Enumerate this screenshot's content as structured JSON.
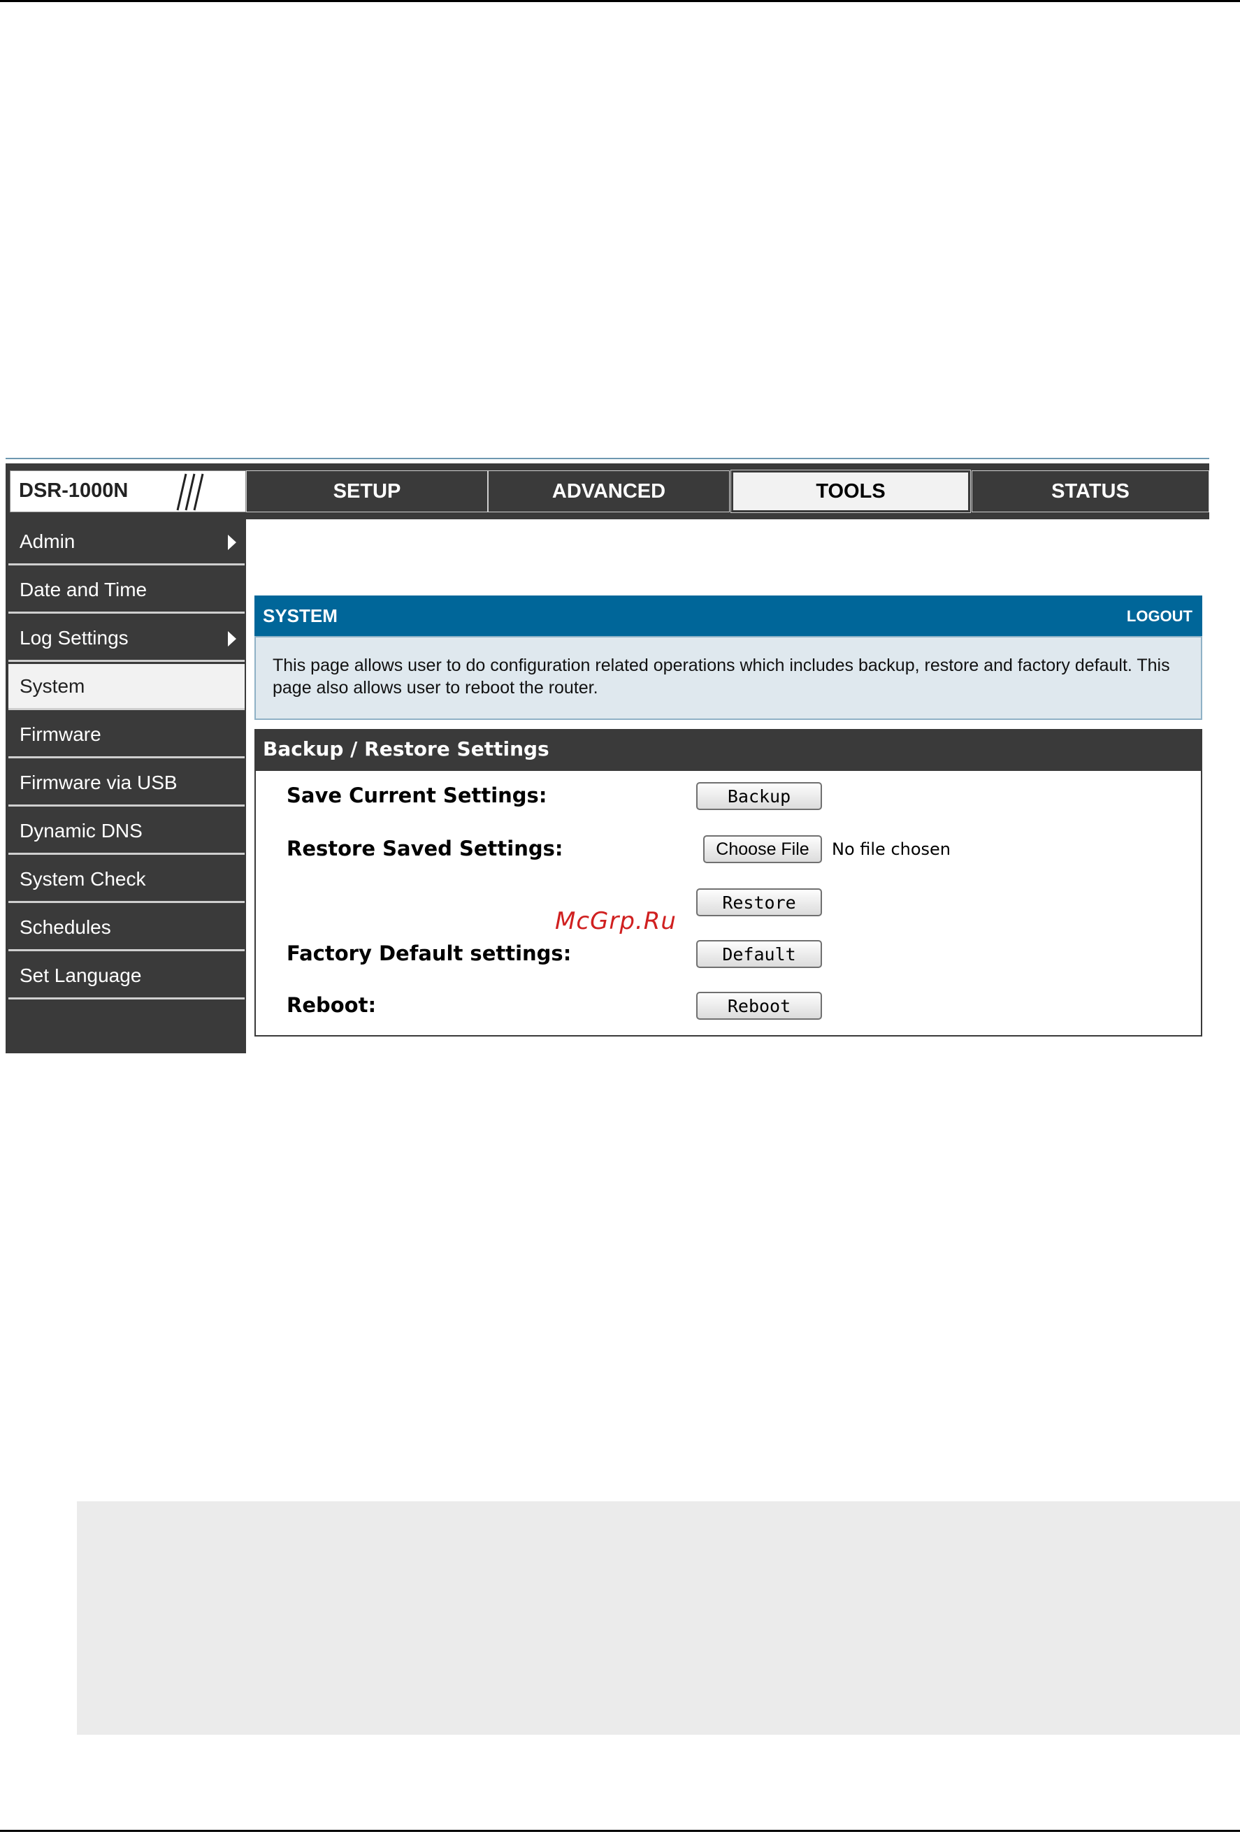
{
  "brand": {
    "model": "DSR-1000N"
  },
  "nav": {
    "tabs": [
      {
        "label": "SETUP"
      },
      {
        "label": "ADVANCED"
      },
      {
        "label": "TOOLS"
      },
      {
        "label": "STATUS"
      }
    ],
    "active_tab": "TOOLS"
  },
  "sidebar": {
    "items": [
      {
        "label": "Admin"
      },
      {
        "label": "Date and Time"
      },
      {
        "label": "Log Settings"
      },
      {
        "label": "System"
      },
      {
        "label": "Firmware"
      },
      {
        "label": "Firmware via USB"
      },
      {
        "label": "Dynamic DNS"
      },
      {
        "label": "System Check"
      },
      {
        "label": "Schedules"
      },
      {
        "label": "Set Language"
      }
    ],
    "active_item": "System"
  },
  "system": {
    "title": "SYSTEM",
    "logout": "LOGOUT",
    "description": "This page allows user to do configuration related operations which includes backup, restore and factory default. This page also allows user to reboot the router."
  },
  "backup_section": {
    "title": "Backup / Restore Settings",
    "save_label": "Save Current Settings:",
    "backup_button": "Backup",
    "restore_label": "Restore Saved Settings:",
    "choose_file_button": "Choose File",
    "file_status": "No file chosen",
    "restore_button": "Restore",
    "factory_label": "Factory Default settings:",
    "default_button": "Default",
    "reboot_label": "Reboot:",
    "reboot_button": "Reboot"
  },
  "watermark": "McGrp.Ru",
  "colors": {
    "header_dark": "#3a3a3a",
    "system_blue": "#006699",
    "description_bg": "#dfe8ee",
    "watermark_red": "#d02020"
  }
}
